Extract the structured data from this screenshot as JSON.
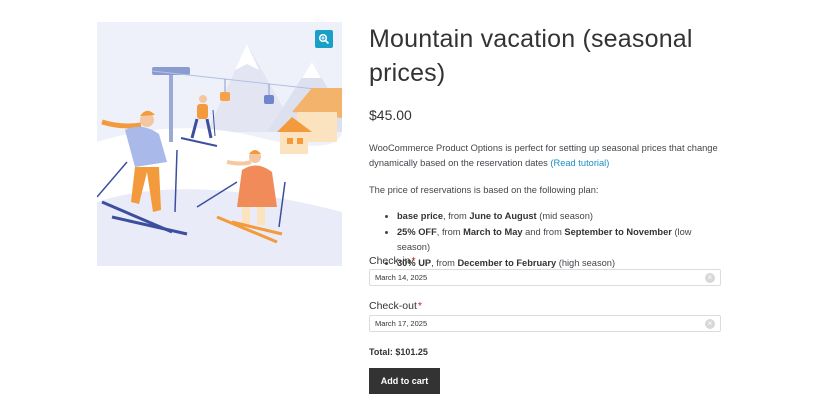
{
  "product": {
    "title": "Mountain vacation (seasonal prices)",
    "price": "$45.00",
    "description_text": "WooCommerce Product Options is perfect for setting up seasonal prices that change dynamically based on the reservation dates ",
    "description_link": "(Read tutorial)",
    "plan_intro": "The price of reservations is based on the following plan:",
    "plan": [
      {
        "bold1": "base price",
        "t1": ", from ",
        "bold2": "June to August",
        "t2": " (mid season)",
        "bold3": "",
        "t3": ""
      },
      {
        "bold1": "25% OFF",
        "t1": ", from ",
        "bold2": "March to May",
        "t2": " and from ",
        "bold3": "September to November",
        "t3": " (low season)"
      },
      {
        "bold1": "30% UP",
        "t1": ", from ",
        "bold2": "December to February",
        "t2": " (high season)",
        "bold3": "",
        "t3": ""
      }
    ]
  },
  "form": {
    "checkin_label": "Check-in",
    "checkin_value": "March 14, 2025",
    "checkout_label": "Check-out",
    "checkout_value": "March 17, 2025",
    "required_mark": "*",
    "clear_symbol": "×",
    "total": "Total: $101.25",
    "add_to_cart": "Add to cart"
  },
  "icons": {
    "zoom": "zoom-in-icon"
  },
  "colors": {
    "accent": "#1aa0c8",
    "button_bg": "#333333",
    "required": "#c0212c",
    "link": "#1a8ec0"
  }
}
